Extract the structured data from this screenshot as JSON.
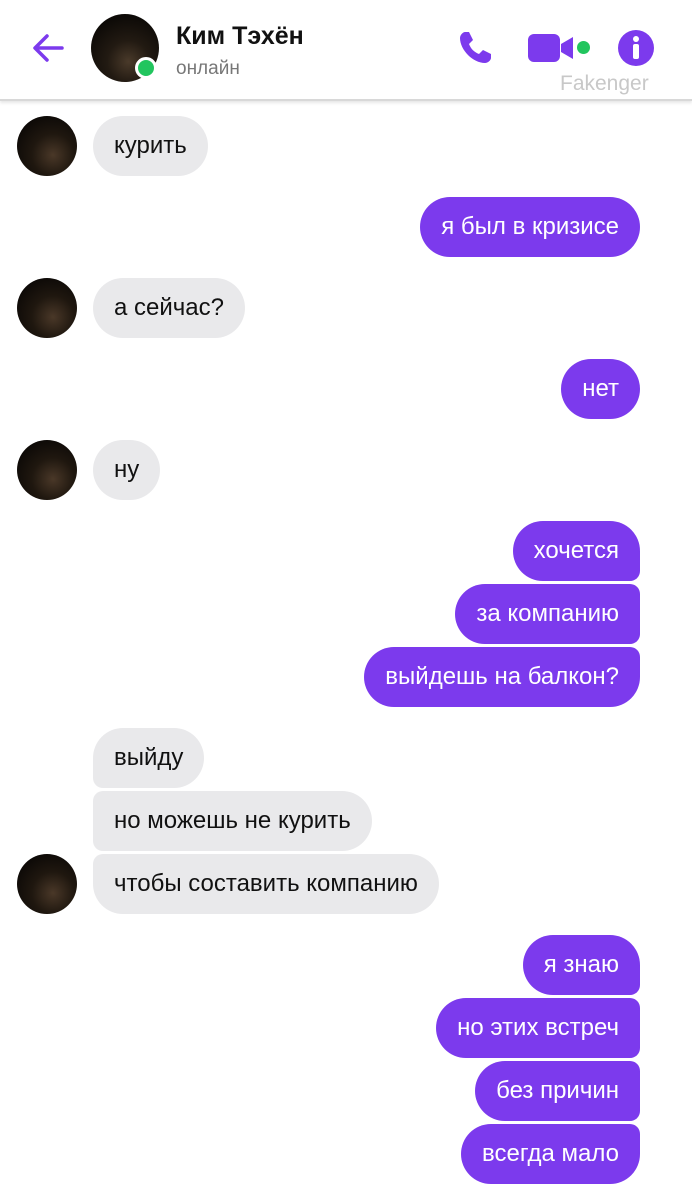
{
  "header": {
    "contact_name": "Ким Тэхён",
    "status": "онлайн",
    "watermark": "Fakenger",
    "icons": [
      "back-arrow-icon",
      "phone-icon",
      "video-camera-icon",
      "info-icon"
    ],
    "accent_color": "#7c3aed",
    "online_color": "#22c55e"
  },
  "messages": [
    {
      "from": "contact",
      "text": "курить"
    },
    {
      "from": "me",
      "text": "я был в кризисе"
    },
    {
      "from": "contact",
      "text": "а сейчас?"
    },
    {
      "from": "me",
      "text": "нет"
    },
    {
      "from": "contact",
      "text": "ну"
    },
    {
      "from": "me",
      "text": "хочется"
    },
    {
      "from": "me",
      "text": "за компанию"
    },
    {
      "from": "me",
      "text": "выйдешь на балкон?"
    },
    {
      "from": "contact",
      "text": "выйду"
    },
    {
      "from": "contact",
      "text": "но можешь не курить"
    },
    {
      "from": "contact",
      "text": "чтобы составить компанию"
    },
    {
      "from": "me",
      "text": "я знаю"
    },
    {
      "from": "me",
      "text": "но этих встреч"
    },
    {
      "from": "me",
      "text": "без причин"
    },
    {
      "from": "me",
      "text": "всегда мало"
    }
  ]
}
